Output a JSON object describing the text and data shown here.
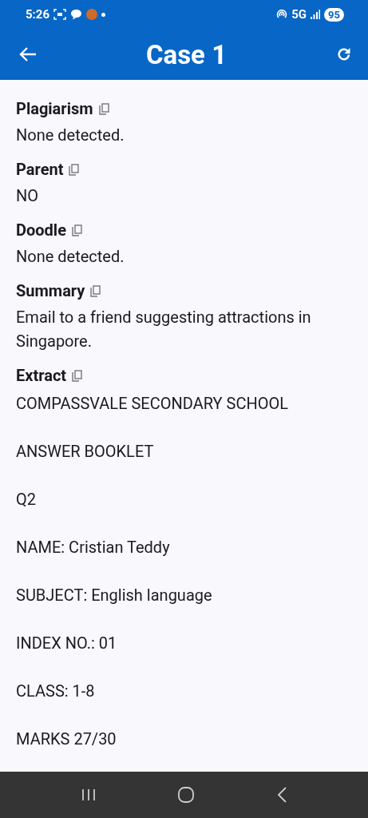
{
  "status_bar": {
    "time": "5:26",
    "network": "5G",
    "battery": "95"
  },
  "app_bar": {
    "title": "Case 1"
  },
  "fields": [
    {
      "label": "Plagiarism",
      "value": "None detected."
    },
    {
      "label": "Parent",
      "value": "NO"
    },
    {
      "label": "Doodle",
      "value": "None detected."
    },
    {
      "label": "Summary",
      "value": "Email to a friend suggesting attractions in Singapore."
    }
  ],
  "extract": {
    "label": "Extract",
    "lines": [
      "COMPASSVALE SECONDARY SCHOOL",
      "ANSWER BOOKLET",
      "Q2",
      "NAME: Cristian Teddy",
      "SUBJECT: English language",
      "INDEX NO.: 01",
      "CLASS: 1-8",
      "MARKS 27/30"
    ]
  }
}
